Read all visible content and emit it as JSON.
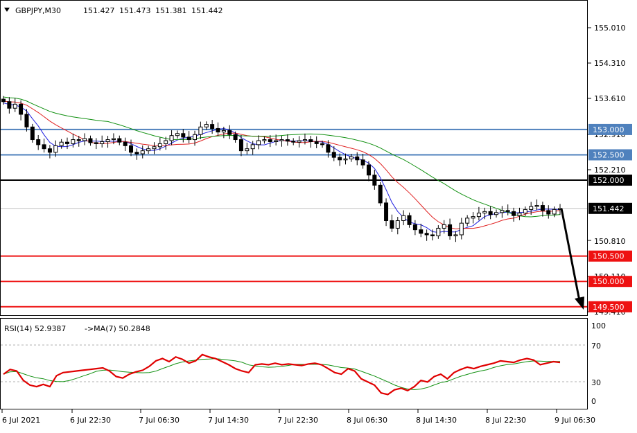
{
  "header": {
    "symbol": "GBPJPY,M30",
    "open": "151.427",
    "high": "151.473",
    "low": "151.381",
    "close": "151.442"
  },
  "rsi_header": {
    "label": "RSI(14) 52.9387",
    "ma_label": "->MA(7) 50.2848"
  },
  "price_axis": {
    "labels": [
      "155.010",
      "154.310",
      "153.610",
      "152.910",
      "152.210",
      "150.810",
      "150.110",
      "149.410"
    ]
  },
  "rsi_axis": {
    "labels": [
      "100",
      "70",
      "30",
      "0"
    ]
  },
  "time_axis": {
    "labels": [
      "6 Jul 2021",
      "6 Jul 22:30",
      "7 Jul 06:30",
      "7 Jul 14:30",
      "7 Jul 22:30",
      "8 Jul 06:30",
      "8 Jul 14:30",
      "8 Jul 22:30",
      "9 Jul 06:30"
    ]
  },
  "levels": [
    {
      "label": "153.000",
      "value": 153.0,
      "color": "#4f81bd",
      "text_color": "#ffffff"
    },
    {
      "label": "152.500",
      "value": 152.5,
      "color": "#4f81bd",
      "text_color": "#ffffff"
    },
    {
      "label": "152.000",
      "value": 152.0,
      "color": "#000000",
      "text_color": "#ffffff"
    },
    {
      "label": "150.500",
      "value": 150.5,
      "color": "#ee1111",
      "text_color": "#ffffff"
    },
    {
      "label": "150.000",
      "value": 150.0,
      "color": "#ee1111",
      "text_color": "#ffffff"
    },
    {
      "label": "149.500",
      "value": 149.5,
      "color": "#ee1111",
      "text_color": "#ffffff"
    }
  ],
  "current_price": {
    "label": "151.442",
    "value": 151.442,
    "color": "#c0c0c0"
  },
  "colors": {
    "ma_fast": "#2020e0",
    "ma_mid": "#e02020",
    "ma_slow": "#109010",
    "rsi_line": "#e00000",
    "rsi_ma": "#109010",
    "candle": "#000000"
  },
  "chart_data": {
    "type": "candlestick",
    "symbol": "GBPJPY",
    "timeframe": "M30",
    "ylim": [
      149.41,
      155.36
    ],
    "rsi_ylim": [
      0,
      100
    ],
    "rsi_levels": [
      70,
      30
    ],
    "close_series": [
      153.55,
      153.42,
      153.5,
      153.3,
      153.05,
      152.8,
      152.7,
      152.62,
      152.55,
      152.68,
      152.75,
      152.72,
      152.8,
      152.78,
      152.82,
      152.74,
      152.72,
      152.76,
      152.8,
      152.82,
      152.75,
      152.68,
      152.55,
      152.52,
      152.58,
      152.62,
      152.66,
      152.72,
      152.78,
      152.88,
      152.92,
      152.85,
      152.8,
      152.9,
      153.05,
      153.1,
      153.02,
      152.95,
      152.98,
      152.9,
      152.8,
      152.58,
      152.62,
      152.7,
      152.78,
      152.8,
      152.76,
      152.78,
      152.8,
      152.77,
      152.75,
      152.78,
      152.8,
      152.76,
      152.72,
      152.7,
      152.55,
      152.45,
      152.4,
      152.42,
      152.46,
      152.4,
      152.3,
      152.1,
      151.9,
      151.55,
      151.2,
      151.05,
      151.2,
      151.3,
      151.12,
      151.02,
      150.95,
      150.92,
      150.9,
      151.05,
      151.12,
      150.9,
      150.92,
      151.15,
      151.25,
      151.28,
      151.35,
      151.38,
      151.32,
      151.36,
      151.4,
      151.38,
      151.3,
      151.35,
      151.42,
      151.48,
      151.5,
      151.4,
      151.33,
      151.42,
      151.44
    ],
    "rsi_series": [
      38,
      44,
      42,
      30,
      24,
      22,
      25,
      22,
      36,
      40,
      41,
      42,
      43,
      44,
      45,
      46,
      42,
      35,
      33,
      38,
      41,
      43,
      48,
      55,
      58,
      54,
      60,
      57,
      52,
      55,
      63,
      60,
      58,
      54,
      50,
      45,
      42,
      40,
      50,
      51,
      50,
      52,
      50,
      51,
      50,
      49,
      51,
      52,
      50,
      45,
      40,
      38,
      45,
      42,
      32,
      28,
      24,
      14,
      12,
      18,
      20,
      17,
      22,
      30,
      28,
      35,
      38,
      32,
      40,
      44,
      47,
      45,
      48,
      50,
      52,
      55,
      54,
      53,
      56,
      58,
      56,
      50,
      52,
      54,
      53
    ]
  }
}
